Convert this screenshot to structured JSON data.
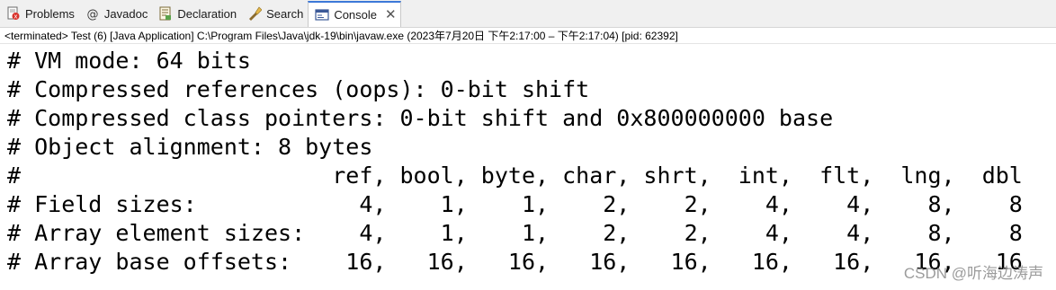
{
  "tabs": [
    {
      "label": "Problems",
      "icon": "problems-icon"
    },
    {
      "label": "Javadoc",
      "icon": "at-icon"
    },
    {
      "label": "Declaration",
      "icon": "declaration-icon"
    },
    {
      "label": "Search",
      "icon": "flashlight-icon"
    },
    {
      "label": "Console",
      "icon": "console-icon",
      "active": true
    }
  ],
  "status": "<terminated> Test (6) [Java Application] C:\\Program Files\\Java\\jdk-19\\bin\\javaw.exe  (2023年7月20日 下午2:17:00 – 下午2:17:04) [pid: 62392]",
  "console": {
    "lines": [
      "# VM mode: 64 bits",
      "# Compressed references (oops): 0-bit shift",
      "# Compressed class pointers: 0-bit shift and 0x800000000 base",
      "# Object alignment: 8 bytes",
      "#                       ref, bool, byte, char, shrt,  int,  flt,  lng,  dbl",
      "# Field sizes:            4,    1,    1,    2,    2,    4,    4,    8,    8",
      "# Array element sizes:    4,    1,    1,    2,    2,    4,    4,    8,    8",
      "# Array base offsets:    16,   16,   16,   16,   16,   16,   16,   16,   16"
    ]
  },
  "watermark": "CSDN @听海边涛声",
  "colors": {
    "active_tab_accent": "#3c78d8",
    "tab_bar_bg": "#f0f0f0",
    "console_text": "#000000"
  }
}
